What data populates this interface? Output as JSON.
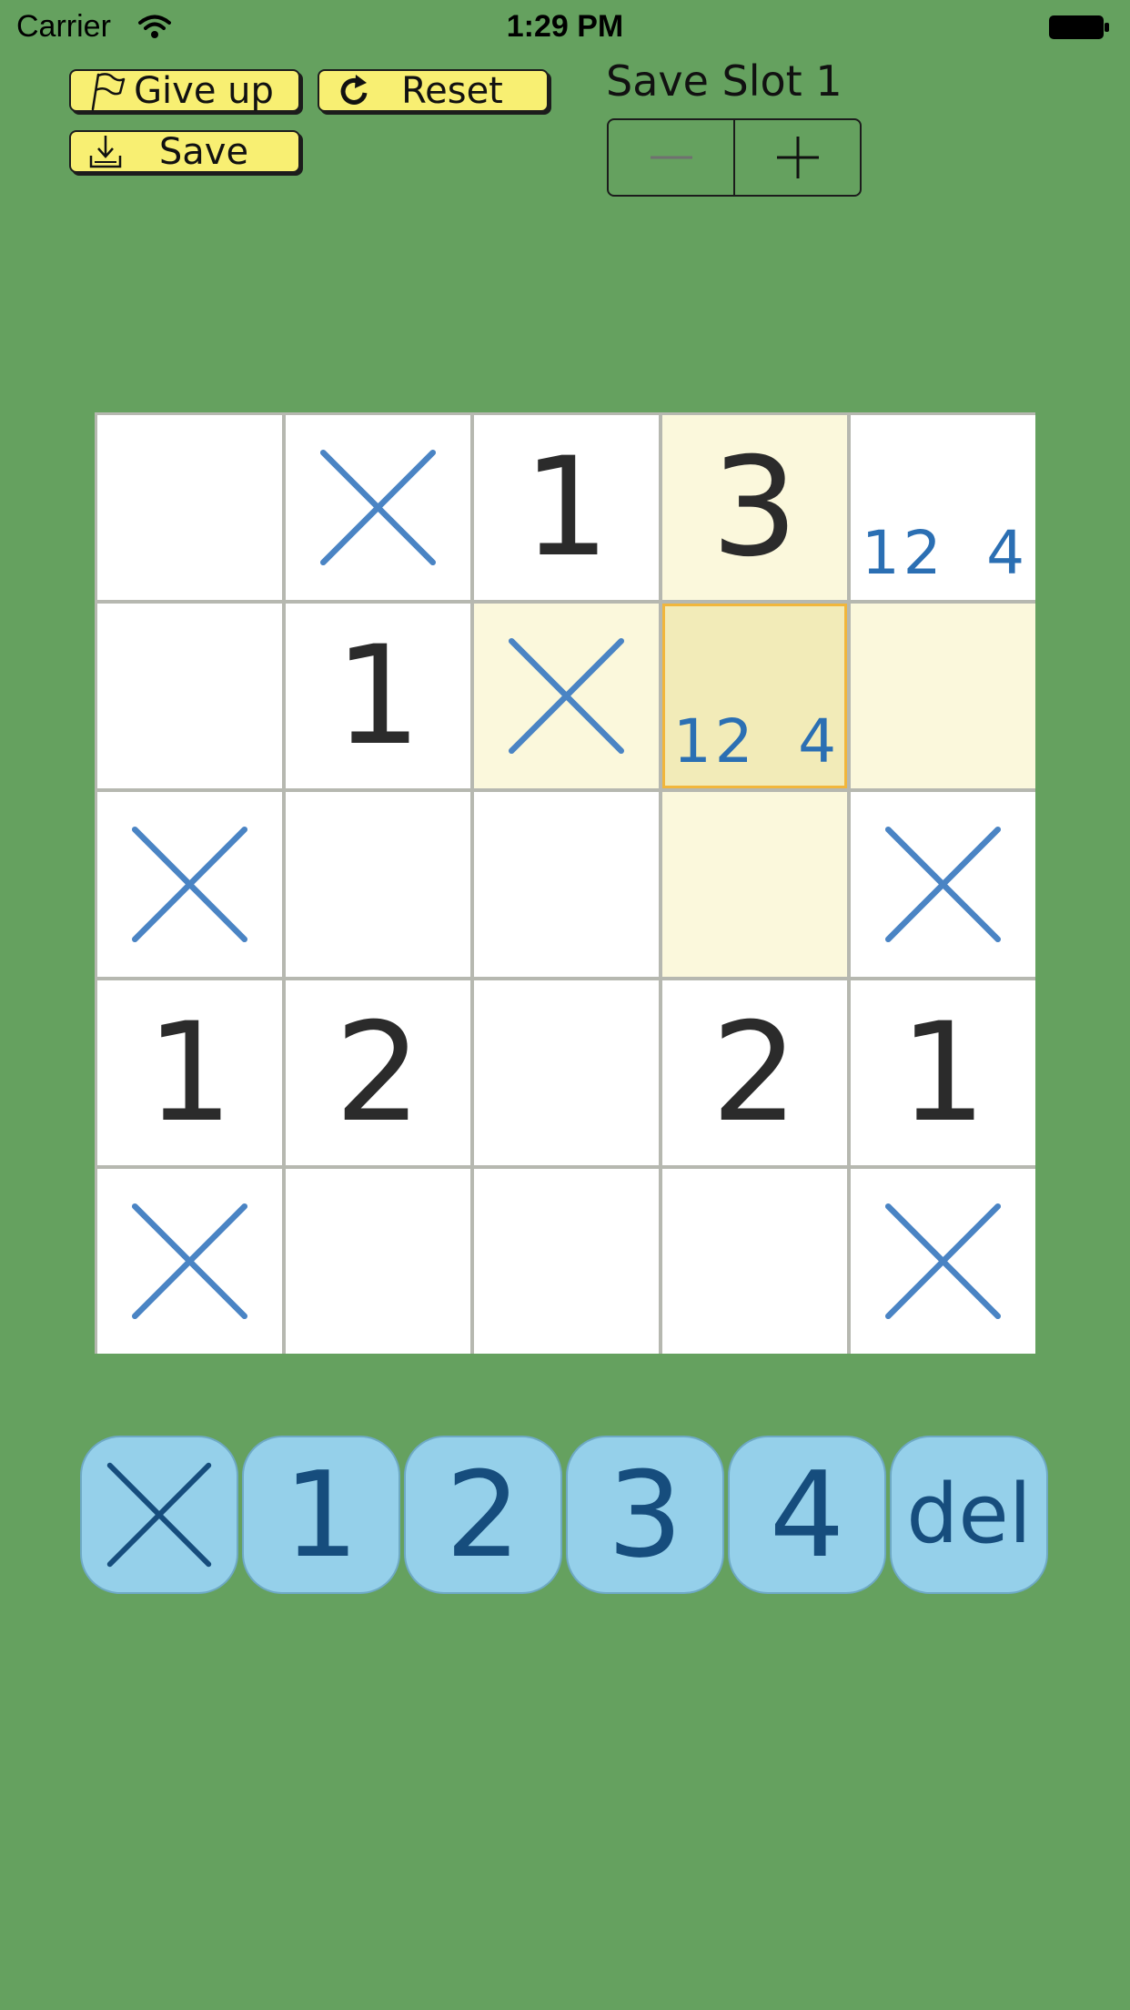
{
  "status_bar": {
    "carrier": "Carrier",
    "time": "1:29 PM"
  },
  "toolbar": {
    "give_up_label": "Give up",
    "reset_label": "Reset",
    "save_label": "Save"
  },
  "save_slot": {
    "label": "Save Slot 1",
    "decrement": "−",
    "increment": "+"
  },
  "board": {
    "size": 5,
    "selected": {
      "row": 1,
      "col": 3
    },
    "highlighted": [
      [
        0,
        3
      ],
      [
        1,
        2
      ],
      [
        1,
        4
      ],
      [
        2,
        3
      ]
    ],
    "cells": [
      [
        {
          "type": "empty"
        },
        {
          "type": "x"
        },
        {
          "type": "number",
          "value": "1"
        },
        {
          "type": "number",
          "value": "3"
        },
        {
          "type": "memo",
          "memo": [
            "1",
            "2",
            "",
            "4"
          ]
        }
      ],
      [
        {
          "type": "empty"
        },
        {
          "type": "number",
          "value": "1"
        },
        {
          "type": "x"
        },
        {
          "type": "memo",
          "memo": [
            "1",
            "2",
            "",
            "4"
          ]
        },
        {
          "type": "empty"
        }
      ],
      [
        {
          "type": "x"
        },
        {
          "type": "empty"
        },
        {
          "type": "empty"
        },
        {
          "type": "empty"
        },
        {
          "type": "x"
        }
      ],
      [
        {
          "type": "number",
          "value": "1"
        },
        {
          "type": "number",
          "value": "2"
        },
        {
          "type": "empty"
        },
        {
          "type": "number",
          "value": "2"
        },
        {
          "type": "number",
          "value": "1"
        }
      ],
      [
        {
          "type": "x"
        },
        {
          "type": "empty"
        },
        {
          "type": "empty"
        },
        {
          "type": "empty"
        },
        {
          "type": "x"
        }
      ]
    ]
  },
  "keypad": {
    "keys": [
      {
        "name": "key-x",
        "type": "x",
        "label": ""
      },
      {
        "name": "key-1",
        "type": "text",
        "label": "1"
      },
      {
        "name": "key-2",
        "type": "text",
        "label": "2"
      },
      {
        "name": "key-3",
        "type": "text",
        "label": "3"
      },
      {
        "name": "key-4",
        "type": "text",
        "label": "4"
      },
      {
        "name": "key-del",
        "type": "text",
        "label": "del"
      }
    ]
  },
  "colors": {
    "background": "#65a15f",
    "button_yellow": "#f8ef72",
    "x_mark": "#4a84c4",
    "memo": "#2b6fb3",
    "key_bg": "#95d0ea",
    "key_text": "#164d7d",
    "selection_outline": "#f1b63c"
  }
}
